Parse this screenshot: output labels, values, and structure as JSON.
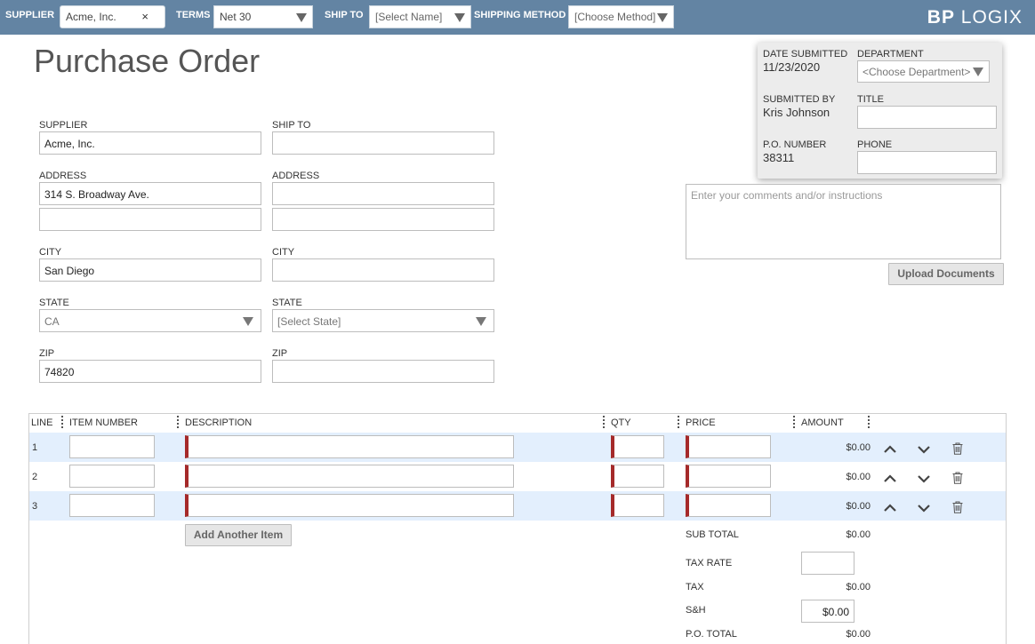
{
  "topbar": {
    "supplier_label": "SUPPLIER",
    "supplier_value": "Acme, Inc.",
    "clear_symbol": "×",
    "terms_label": "TERMS",
    "terms_value": "Net 30",
    "shipto_label": "SHIP TO",
    "shipto_value": "[Select Name]",
    "shipping_method_label": "SHIPPING METHOD",
    "shipping_method_value": "[Choose Method]",
    "logo_bold": "BP",
    "logo_rest": " LOGIX",
    "bar_color": "#6384a3"
  },
  "page_title": "Purchase Order",
  "supplier": {
    "supplier_label": "SUPPLIER",
    "supplier_value": "Acme, Inc.",
    "address_label": "ADDRESS",
    "address1": "314 S. Broadway Ave.",
    "address2": "",
    "city_label": "CITY",
    "city": "San Diego",
    "state_label": "STATE",
    "state": "CA",
    "zip_label": "ZIP",
    "zip": "74820"
  },
  "shipto": {
    "shipto_label": "SHIP TO",
    "shipto_value": "",
    "address_label": "ADDRESS",
    "address1": "",
    "address2": "",
    "city_label": "CITY",
    "city": "",
    "state_label": "STATE",
    "state_placeholder": "[Select State]",
    "zip_label": "ZIP",
    "zip": ""
  },
  "info": {
    "date_submitted_label": "DATE SUBMITTED",
    "date_submitted": "11/23/2020",
    "department_label": "DEPARTMENT",
    "department_placeholder": "<Choose Department>",
    "submitted_by_label": "SUBMITTED BY",
    "submitted_by": "Kris Johnson",
    "title_label": "TITLE",
    "po_number_label": "P.O. NUMBER",
    "po_number": "38311",
    "phone_label": "PHONE"
  },
  "comments_placeholder": "Enter your comments and/or instructions",
  "upload_button": "Upload Documents",
  "items": {
    "headers": {
      "line": "LINE",
      "item_number": "ITEM NUMBER",
      "description": "DESCRIPTION",
      "qty": "QTY",
      "price": "PRICE",
      "amount": "AMOUNT"
    },
    "rows": [
      {
        "line": "1",
        "amount": "$0.00"
      },
      {
        "line": "2",
        "amount": "$0.00"
      },
      {
        "line": "3",
        "amount": "$0.00"
      }
    ],
    "add_button": "Add Another Item",
    "required_color": "#a52a2a",
    "alt_row_color": "#e3effd"
  },
  "totals": {
    "subtotal_label": "SUB TOTAL",
    "subtotal": "$0.00",
    "tax_rate_label": "TAX RATE",
    "tax_label": "TAX",
    "tax": "$0.00",
    "sh_label": "S&H",
    "sh_value": "$0.00",
    "po_total_label": "P.O. TOTAL",
    "po_total": "$0.00"
  },
  "icons": [
    "chevron-down-icon",
    "clear-icon",
    "chevron-up-icon",
    "trash-icon"
  ]
}
